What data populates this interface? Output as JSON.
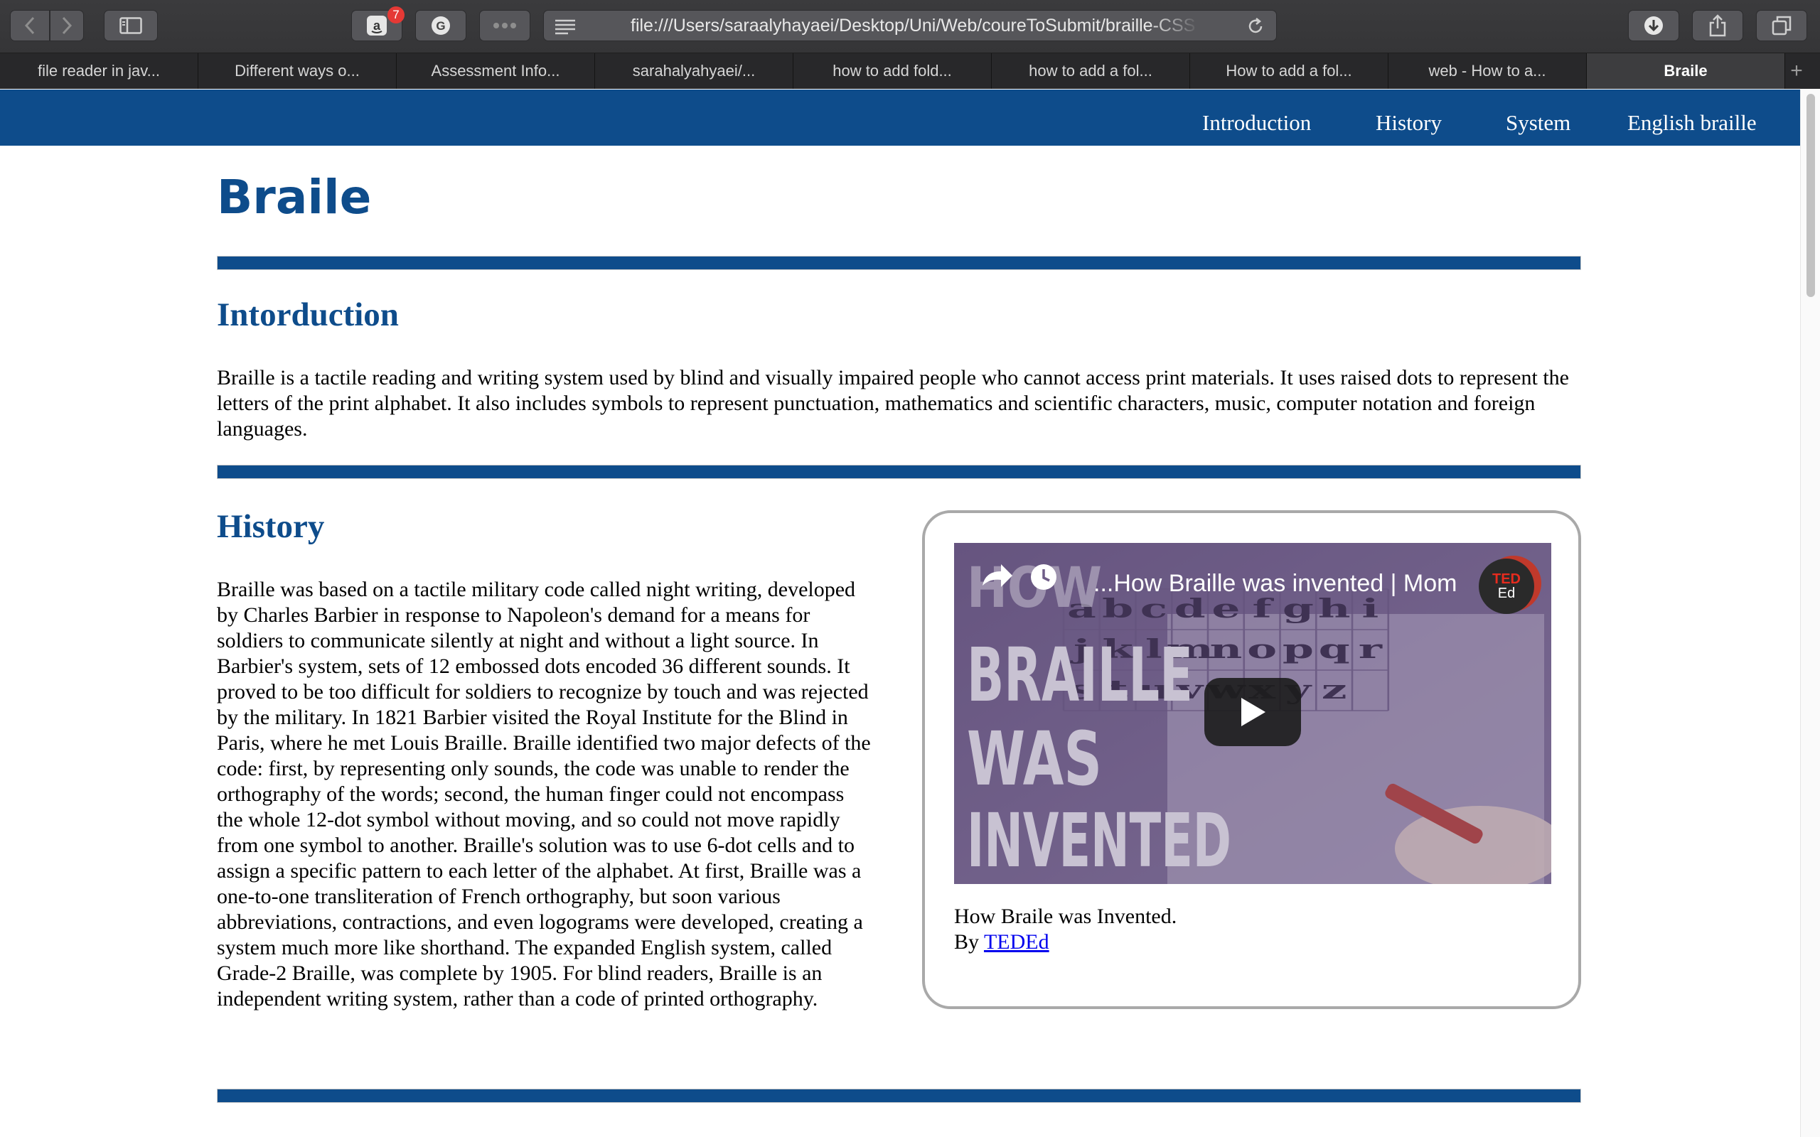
{
  "browser": {
    "url": "file:///Users/saraalyhayaei/Desktop/Uni/Web/coureToSubmit/braille-CSS",
    "amazon_badge": "7",
    "tabs": [
      {
        "label": "file reader in jav..."
      },
      {
        "label": "Different ways o..."
      },
      {
        "label": "Assessment Info..."
      },
      {
        "label": "sarahalyahyaei/..."
      },
      {
        "label": "how to add fold..."
      },
      {
        "label": "how to add a fol..."
      },
      {
        "label": "How to add a fol..."
      },
      {
        "label": "web - How to a..."
      },
      {
        "label": "Braile"
      }
    ],
    "active_tab_index": 8,
    "new_tab_label": "+"
  },
  "nav": {
    "items": [
      {
        "label": "Introduction"
      },
      {
        "label": "History"
      },
      {
        "label": "System"
      },
      {
        "label": "English braille"
      }
    ]
  },
  "page": {
    "title": "Braile",
    "intro": {
      "heading": "Intorduction",
      "text": "Braille is a tactile reading and writing system used by blind and visually impaired people who cannot access print materials. It uses raised dots to represent the letters of the print alphabet. It also includes symbols to represent punctuation, mathematics and scientific characters, music, computer notation and foreign languages."
    },
    "history": {
      "heading": "History",
      "text": "Braille was based on a tactile military code called night writing, developed by Charles Barbier in response to Napoleon's demand for a means for soldiers to communicate silently at night and without a light source. In Barbier's system, sets of 12 embossed dots encoded 36 different sounds. It proved to be too difficult for soldiers to recognize by touch and was rejected by the military. In 1821 Barbier visited the Royal Institute for the Blind in Paris, where he met Louis Braille. Braille identified two major defects of the code: first, by representing only sounds, the code was unable to render the orthography of the words; second, the human finger could not encompass the whole 12-dot symbol without moving, and so could not move rapidly from one symbol to another. Braille's solution was to use 6-dot cells and to assign a specific pattern to each letter of the alphabet. At first, Braille was a one-to-one transliteration of French orthography, but soon various abbreviations, contractions, and even logograms were developed, creating a system much more like shorthand. The expanded English system, called Grade-2 Braille, was complete by 1905. For blind readers, Braille is an independent writing system, rather than a code of printed orthography."
    },
    "video": {
      "title": "...How Braille was invented | Mom",
      "thumbnail_text": [
        "HOW",
        "BRAILLE",
        "WAS",
        "INVENTED"
      ],
      "grid_rows": [
        [
          "a",
          "b",
          "c",
          "d",
          "e",
          "f",
          "g",
          "h",
          "i"
        ],
        [
          "j",
          "k",
          "l",
          "m",
          "n",
          "o",
          "p",
          "q",
          "r"
        ],
        [
          "s",
          "t",
          "u",
          "v",
          "w",
          "x",
          "y",
          "z",
          ""
        ]
      ],
      "channel_logo": {
        "line1": "TED",
        "line2": "Ed"
      },
      "caption": "How Braile was Invented.",
      "credit_prefix": "By ",
      "credit_link": "TEDEd"
    }
  },
  "colors": {
    "nav_bg": "#0e4c8b",
    "heading": "#0e4c8b",
    "link": "#0000ee",
    "card_border": "#a9a9a9"
  },
  "icons": [
    "back-arrow-icon",
    "forward-arrow-icon",
    "sidebar-icon",
    "amazon-icon",
    "grammarly-icon",
    "extension-dots-icon",
    "reader-icon",
    "reload-icon",
    "download-icon",
    "share-icon",
    "tabs-overview-icon",
    "play-icon",
    "share-video-icon",
    "watch-later-icon"
  ]
}
